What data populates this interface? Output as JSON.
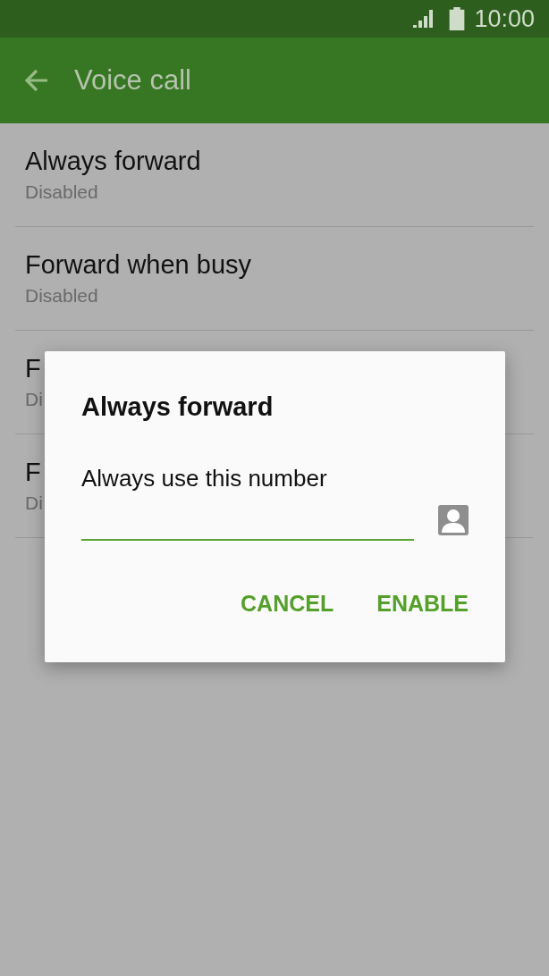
{
  "status_bar": {
    "time": "10:00"
  },
  "toolbar": {
    "title": "Voice call"
  },
  "settings": [
    {
      "title": "Always forward",
      "summary": "Disabled"
    },
    {
      "title": "Forward when busy",
      "summary": "Disabled"
    },
    {
      "title": "F",
      "summary": "Di"
    },
    {
      "title": "F",
      "summary": "Di"
    }
  ],
  "dialog": {
    "title": "Always forward",
    "label": "Always use this number",
    "buttons": [
      "CANCEL",
      "ENABLE"
    ]
  }
}
